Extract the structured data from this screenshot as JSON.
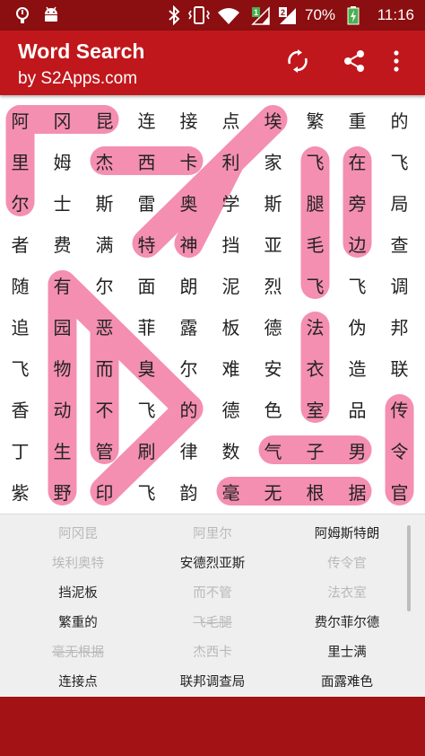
{
  "status_bar": {
    "battery_percent": "70%",
    "time": "11:16",
    "icons": [
      "alert-icon",
      "android-icon",
      "bluetooth-icon",
      "vibrate-icon",
      "wifi-icon",
      "signal-1-icon",
      "signal-2-icon",
      "battery-charging-icon"
    ]
  },
  "app_bar": {
    "title": "Word Search",
    "subtitle": "by S2Apps.com",
    "actions": [
      "refresh-icon",
      "share-icon",
      "more-vert-icon"
    ]
  },
  "grid": {
    "rows": [
      [
        "阿",
        "冈",
        "昆",
        "连",
        "接",
        "点",
        "埃",
        "繁",
        "重",
        "的"
      ],
      [
        "里",
        "姆",
        "杰",
        "西",
        "卡",
        "利",
        "家",
        "飞",
        "在",
        "飞"
      ],
      [
        "尔",
        "士",
        "斯",
        "雷",
        "奥",
        "学",
        "斯",
        "腿",
        "旁",
        "局"
      ],
      [
        "者",
        "费",
        "满",
        "特",
        "神",
        "挡",
        "亚",
        "毛",
        "边",
        "查"
      ],
      [
        "随",
        "有",
        "尔",
        "面",
        "朗",
        "泥",
        "烈",
        "飞",
        "飞",
        "调"
      ],
      [
        "追",
        "园",
        "恶",
        "菲",
        "露",
        "板",
        "德",
        "法",
        "伪",
        "邦"
      ],
      [
        "飞",
        "物",
        "而",
        "臭",
        "尔",
        "难",
        "安",
        "衣",
        "造",
        "联"
      ],
      [
        "香",
        "动",
        "不",
        "飞",
        "的",
        "德",
        "色",
        "室",
        "品",
        "传"
      ],
      [
        "丁",
        "生",
        "管",
        "刷",
        "律",
        "数",
        "气",
        "子",
        "男",
        "令"
      ],
      [
        "紫",
        "野",
        "印",
        "飞",
        "韵",
        "毫",
        "无",
        "根",
        "据",
        "官"
      ]
    ]
  },
  "highlight_color": "#f48fb1",
  "word_list": [
    {
      "text": "阿冈昆",
      "found": true,
      "struck": false
    },
    {
      "text": "阿里尔",
      "found": true,
      "struck": false
    },
    {
      "text": "阿姆斯特朗",
      "found": false,
      "struck": false
    },
    {
      "text": "埃利奥特",
      "found": true,
      "struck": false
    },
    {
      "text": "安德烈亚斯",
      "found": false,
      "struck": false
    },
    {
      "text": "传令官",
      "found": true,
      "struck": false
    },
    {
      "text": "挡泥板",
      "found": false,
      "struck": false
    },
    {
      "text": "而不管",
      "found": true,
      "struck": false
    },
    {
      "text": "法衣室",
      "found": true,
      "struck": false
    },
    {
      "text": "繁重的",
      "found": false,
      "struck": false
    },
    {
      "text": "飞毛腿",
      "found": true,
      "struck": true
    },
    {
      "text": "费尔菲尔德",
      "found": false,
      "struck": false
    },
    {
      "text": "毫无根据",
      "found": true,
      "struck": true
    },
    {
      "text": "杰西卡",
      "found": true,
      "struck": false
    },
    {
      "text": "里士满",
      "found": false,
      "struck": false
    },
    {
      "text": "连接点",
      "found": false,
      "struck": false
    },
    {
      "text": "联邦调查局",
      "found": false,
      "struck": false
    },
    {
      "text": "面露难色",
      "found": false,
      "struck": false
    }
  ]
}
